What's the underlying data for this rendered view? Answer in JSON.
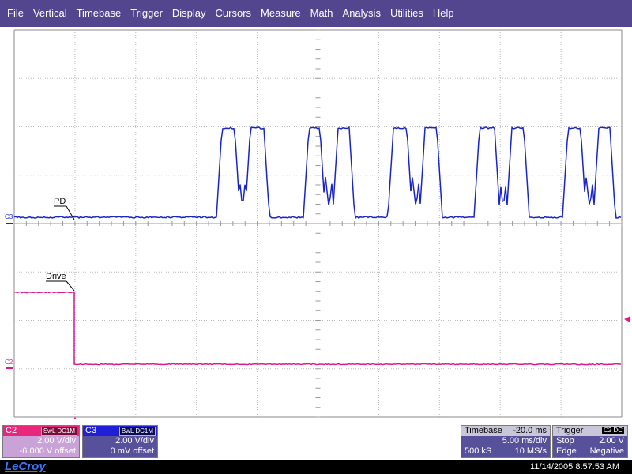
{
  "menu": [
    "File",
    "Vertical",
    "Timebase",
    "Trigger",
    "Display",
    "Cursors",
    "Measure",
    "Math",
    "Analysis",
    "Utilities",
    "Help"
  ],
  "traces": {
    "c3": {
      "tag": "C3",
      "label": "PD",
      "color": "#1a25c8"
    },
    "c2": {
      "tag": "C2",
      "label": "Drive",
      "color": "#d81a8a"
    }
  },
  "channels": {
    "c2": {
      "name": "C2",
      "badge": "SwL DC1M",
      "scale": "2.00 V/div",
      "offset": "-6.000 V offset",
      "bg": "#c9a2d8",
      "head_bg": "#e8277c"
    },
    "c3": {
      "name": "C3",
      "badge": "BwL DC1M",
      "scale": "2.00 V/div",
      "offset": "0 mV offset",
      "bg": "#57509a",
      "head_bg": "#1f1fd6"
    }
  },
  "timebase": {
    "label": "Timebase",
    "delay": "-20.0 ms",
    "scale": "5.00 ms/div",
    "samples": "500 kS",
    "rate": "10 MS/s"
  },
  "trigger": {
    "label": "Trigger",
    "badge": "C2 DC",
    "mode": "Stop",
    "level": "2.00 V",
    "type": "Edge",
    "slope": "Negative"
  },
  "status": {
    "logo": "LeCroy",
    "timestamp": "11/14/2005 8:57:53 AM"
  }
}
